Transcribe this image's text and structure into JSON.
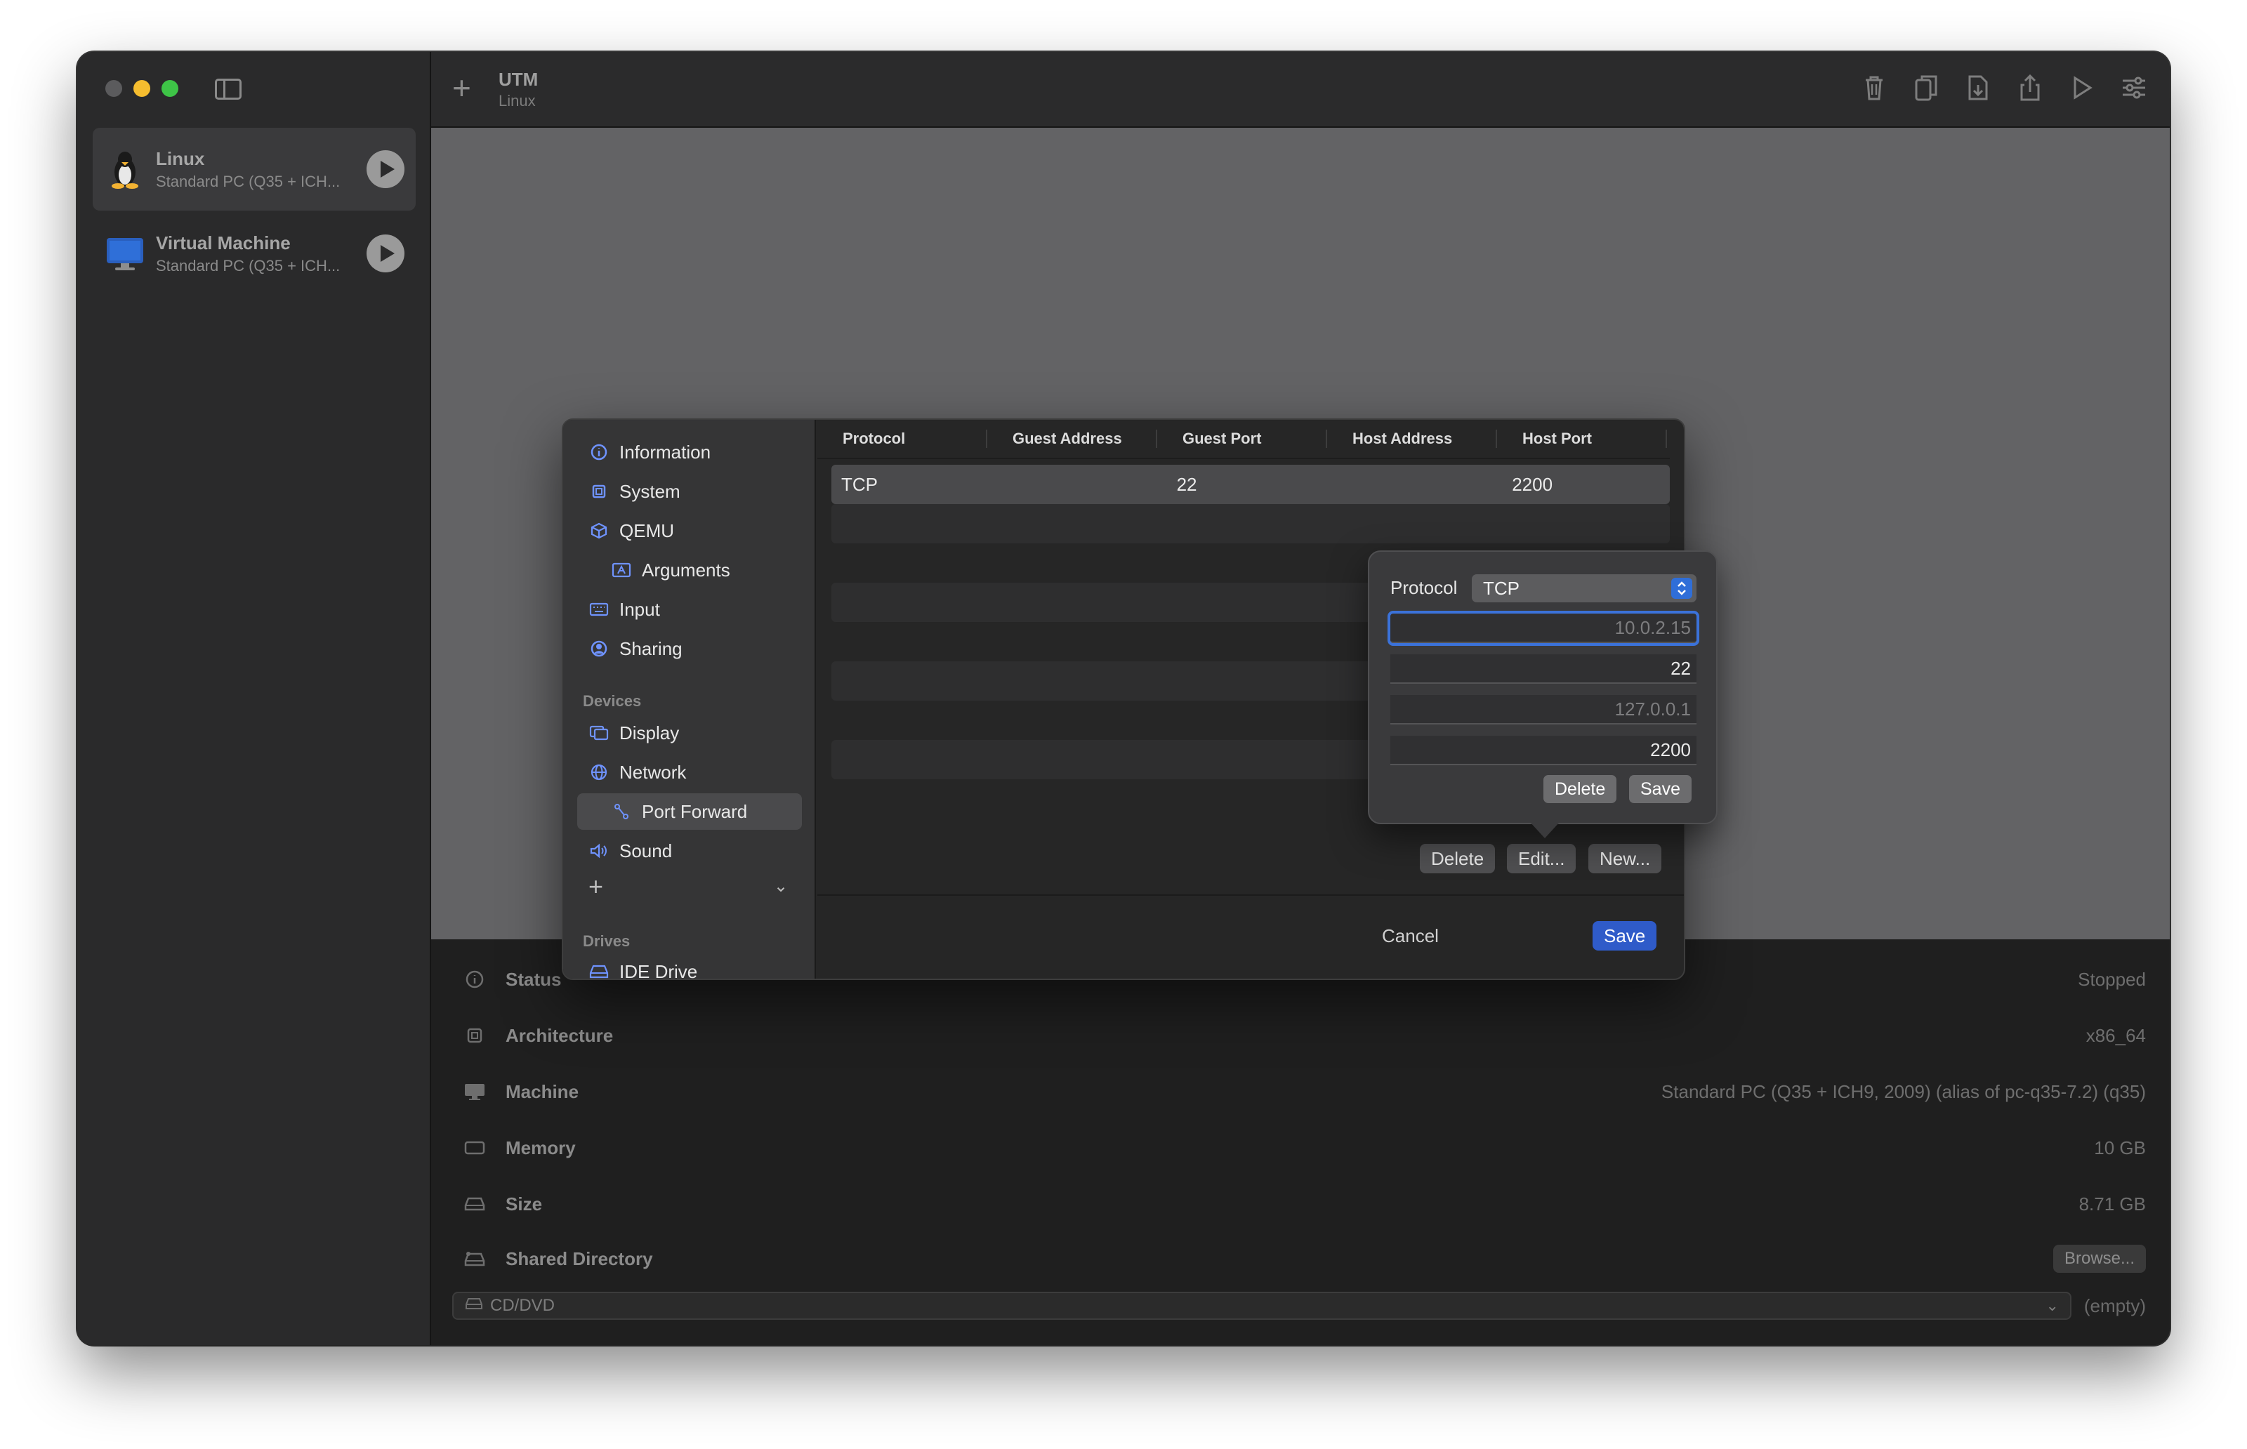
{
  "window": {
    "traffic_lights": [
      "close",
      "minimize",
      "maximize"
    ]
  },
  "sidebar": {
    "vms": [
      {
        "name": "Linux",
        "subtitle": "Standard PC (Q35 + ICH...",
        "icon": "linux-penguin-icon"
      },
      {
        "name": "Virtual Machine",
        "subtitle": "Standard PC (Q35 + ICH...",
        "icon": "monitor-icon"
      }
    ]
  },
  "toolbar": {
    "add_label": "+",
    "title": "UTM",
    "subtitle": "Linux",
    "actions": [
      "trash-icon",
      "clone-icon",
      "export-icon",
      "share-icon",
      "play-icon",
      "settings-icon"
    ]
  },
  "details": {
    "rows": [
      {
        "label": "Status",
        "value": "Stopped",
        "icon": "info-icon"
      },
      {
        "label": "Architecture",
        "value": "x86_64",
        "icon": "cpu-icon"
      },
      {
        "label": "Machine",
        "value": "Standard PC (Q35 + ICH9, 2009) (alias of pc-q35-7.2) (q35)",
        "icon": "monitor-icon"
      },
      {
        "label": "Memory",
        "value": "10 GB",
        "icon": "memory-icon"
      },
      {
        "label": "Size",
        "value": "8.71 GB",
        "icon": "drive-icon"
      },
      {
        "label": "Shared Directory",
        "value": "Browse...",
        "icon": "shared-drive-icon"
      }
    ],
    "cd_label": "CD/DVD",
    "cd_value": "(empty)"
  },
  "settings": {
    "nav": [
      {
        "label": "Information",
        "icon": "info-icon"
      },
      {
        "label": "System",
        "icon": "cpu-icon"
      },
      {
        "label": "QEMU",
        "icon": "cube-icon"
      },
      {
        "label": "Arguments",
        "icon": "arguments-icon"
      },
      {
        "label": "Input",
        "icon": "keyboard-icon"
      },
      {
        "label": "Sharing",
        "icon": "person-icon"
      }
    ],
    "devices_header": "Devices",
    "devices": [
      {
        "label": "Display",
        "icon": "display-icon"
      },
      {
        "label": "Network",
        "icon": "globe-icon"
      },
      {
        "label": "Port Forward",
        "icon": "port-forward-icon"
      },
      {
        "label": "Sound",
        "icon": "speaker-icon"
      }
    ],
    "add_label": "+",
    "drives_header": "Drives",
    "drives": [
      {
        "label": "IDE Drive",
        "icon": "drive-icon"
      }
    ],
    "table": {
      "columns": [
        "Protocol",
        "Guest Address",
        "Guest Port",
        "Host Address",
        "Host Port"
      ],
      "rows": [
        {
          "protocol": "TCP",
          "guest_address": "",
          "guest_port": "22",
          "host_address": "",
          "host_port": "2200"
        }
      ]
    },
    "buttons": {
      "delete": "Delete",
      "edit": "Edit...",
      "new": "New...",
      "cancel": "Cancel",
      "save": "Save"
    },
    "popover": {
      "protocol_label": "Protocol",
      "protocol_value": "TCP",
      "guest_address_placeholder": "10.0.2.15",
      "guest_port": "22",
      "host_address_placeholder": "127.0.0.1",
      "host_port": "2200",
      "delete": "Delete",
      "save": "Save"
    }
  }
}
